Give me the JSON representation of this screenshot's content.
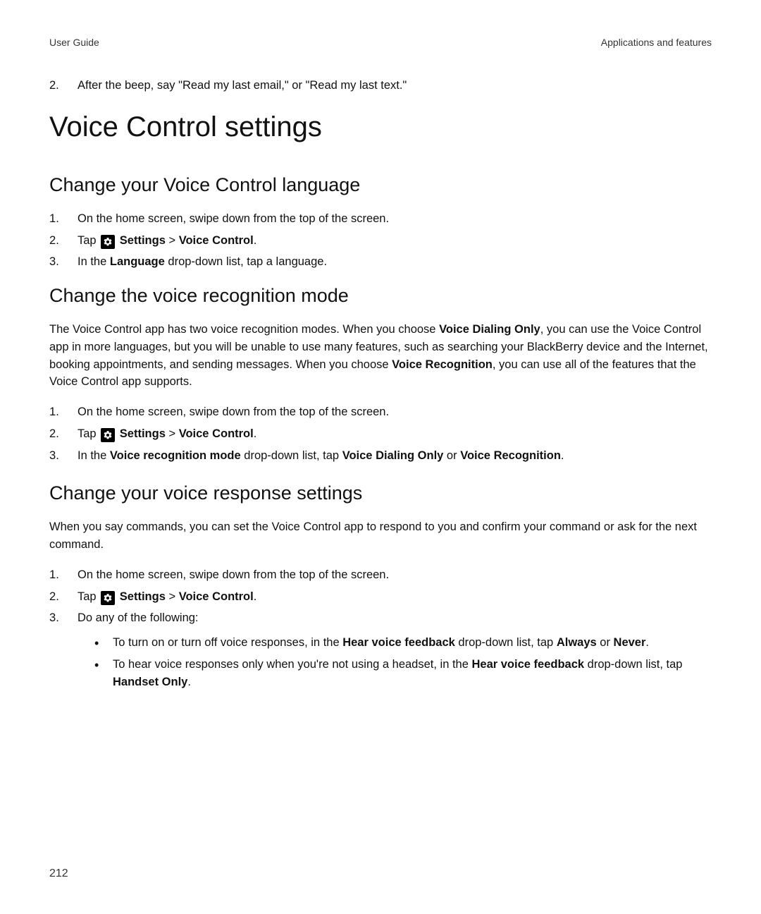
{
  "header": {
    "left": "User Guide",
    "right": "Applications and features"
  },
  "intro_step": {
    "num": "2.",
    "text": "After the beep, say \"Read my last email,\" or \"Read my last text.\""
  },
  "h1": "Voice Control settings",
  "section1": {
    "title": "Change your Voice Control language",
    "steps": {
      "s1": "On the home screen, swipe down from the top of the screen.",
      "s2_tap": "Tap ",
      "s2_settings": "Settings",
      "s2_sep": " > ",
      "s2_vc": "Voice Control",
      "s2_end": ".",
      "s3_a": "In the ",
      "s3_b": "Language",
      "s3_c": " drop-down list, tap a language."
    }
  },
  "section2": {
    "title": "Change the voice recognition mode",
    "para_a": "The Voice Control app has two voice recognition modes. When you choose ",
    "para_b": "Voice Dialing Only",
    "para_c": ", you can use the Voice Control app in more languages, but you will be unable to use many features, such as searching your BlackBerry device and the Internet, booking appointments, and sending messages. When you choose ",
    "para_d": "Voice Recognition",
    "para_e": ", you can use all of the features that the Voice Control app supports.",
    "steps": {
      "s1": "On the home screen, swipe down from the top of the screen.",
      "s2_tap": "Tap ",
      "s2_settings": "Settings",
      "s2_sep": " > ",
      "s2_vc": "Voice Control",
      "s2_end": ".",
      "s3_a": "In the ",
      "s3_b": "Voice recognition mode",
      "s3_c": " drop-down list, tap ",
      "s3_d": "Voice Dialing Only",
      "s3_e": " or ",
      "s3_f": "Voice Recognition",
      "s3_g": "."
    }
  },
  "section3": {
    "title": "Change your voice response settings",
    "para": "When you say commands, you can set the Voice Control app to respond to you and confirm your command or ask for the next command.",
    "steps": {
      "s1": "On the home screen, swipe down from the top of the screen.",
      "s2_tap": "Tap ",
      "s2_settings": "Settings",
      "s2_sep": " > ",
      "s2_vc": "Voice Control",
      "s2_end": ".",
      "s3": "Do any of the following:"
    },
    "bullets": {
      "b1_a": "To turn on or turn off voice responses, in the ",
      "b1_b": "Hear voice feedback",
      "b1_c": " drop-down list, tap ",
      "b1_d": "Always",
      "b1_e": " or ",
      "b1_f": "Never",
      "b1_g": ".",
      "b2_a": "To hear voice responses only when you're not using a headset, in the ",
      "b2_b": "Hear voice feedback",
      "b2_c": " drop-down list, tap ",
      "b2_d": "Handset Only",
      "b2_e": "."
    }
  },
  "page_number": "212"
}
